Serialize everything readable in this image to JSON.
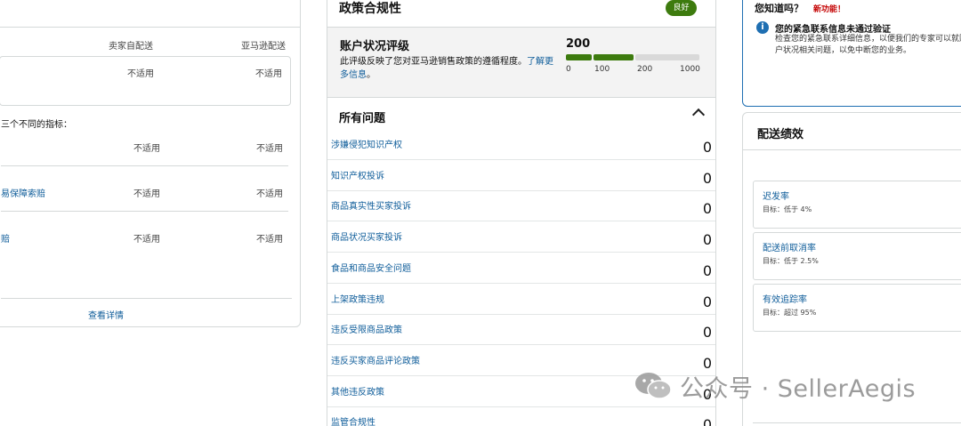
{
  "left_panel": {
    "col_seller": "卖家自配送",
    "col_amazon": "亚马逊配送",
    "box_values": [
      "不适用",
      "不适用"
    ],
    "note": "三个不同的指标：",
    "rows": [
      {
        "label": "",
        "seller": "不适用",
        "amazon": "不适用"
      },
      {
        "label": "易保障索赔",
        "seller": "不适用",
        "amazon": "不适用"
      },
      {
        "label": "赔",
        "seller": "不适用",
        "amazon": "不适用"
      }
    ],
    "footer_link": "查看详情"
  },
  "policy": {
    "title": "政策合规性",
    "badge": "良好",
    "rating_title": "账户状况评级",
    "rating_desc": "此评级反映了您对亚马逊销售政策的遵循程度。",
    "rating_link": "了解更多信息",
    "score": "200",
    "scale_ticks": [
      "0",
      "100",
      "200",
      "1000"
    ],
    "score_fraction": 0.2,
    "issues_title": "所有问题",
    "issues": [
      {
        "label": "涉嫌侵犯知识产权",
        "count": "0"
      },
      {
        "label": "知识产权投诉",
        "count": "0"
      },
      {
        "label": "商品真实性买家投诉",
        "count": "0"
      },
      {
        "label": "商品状况买家投诉",
        "count": "0"
      },
      {
        "label": "食品和商品安全问题",
        "count": "0"
      },
      {
        "label": "上架政策违规",
        "count": "0"
      },
      {
        "label": "违反受限商品政策",
        "count": "0"
      },
      {
        "label": "违反买家商品评论政策",
        "count": "0"
      },
      {
        "label": "其他违反政策",
        "count": "0"
      },
      {
        "label": "监管合规性",
        "count": "0"
      }
    ]
  },
  "did_you_know": {
    "question": "您知道吗？",
    "new_feature": "新功能！",
    "alert_title": "您的紧急联系信息未通过验证",
    "alert_body": "检查您的紧急联系详细信息，以便我们的专家可以就账户状况相关问题，以免中断您的业务。"
  },
  "shipping": {
    "title": "配送绩效",
    "metrics": [
      {
        "name": "迟发率",
        "target": "目标：低于 4%"
      },
      {
        "name": "配送前取消率",
        "target": "目标：低于 2.5%"
      },
      {
        "name": "有效追踪率",
        "target": "目标：超过 95%"
      }
    ]
  },
  "watermark": {
    "text": "公众号 · SellerAegis"
  },
  "colors": {
    "link": "#0f5d9a",
    "good_badge": "#3d7b0e",
    "info_blue": "#1f6fb2",
    "new_red": "#c40000"
  }
}
